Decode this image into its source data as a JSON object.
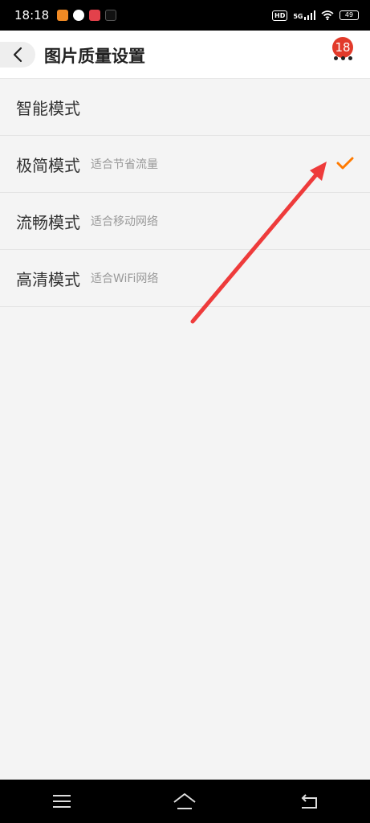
{
  "status_bar": {
    "time": "18:18",
    "network": "5G",
    "hd": "HD",
    "battery": "49"
  },
  "header": {
    "title": "图片质量设置",
    "badge_count": "18"
  },
  "modes": [
    {
      "name": "智能模式",
      "desc": "",
      "selected": false
    },
    {
      "name": "极简模式",
      "desc": "适合节省流量",
      "selected": true
    },
    {
      "name": "流畅模式",
      "desc": "适合移动网络",
      "selected": false
    },
    {
      "name": "高清模式",
      "desc": "适合WiFi网络",
      "selected": false
    }
  ],
  "colors": {
    "accent": "#ff7a00",
    "badge": "#e23a2a",
    "annotation": "#ee3b3b"
  },
  "icons": {
    "back": "chevron-left-icon",
    "more": "more-dots-icon",
    "check": "check-icon",
    "nav_menu": "menu-icon",
    "nav_home": "home-icon",
    "nav_back": "back-arrow-icon"
  }
}
